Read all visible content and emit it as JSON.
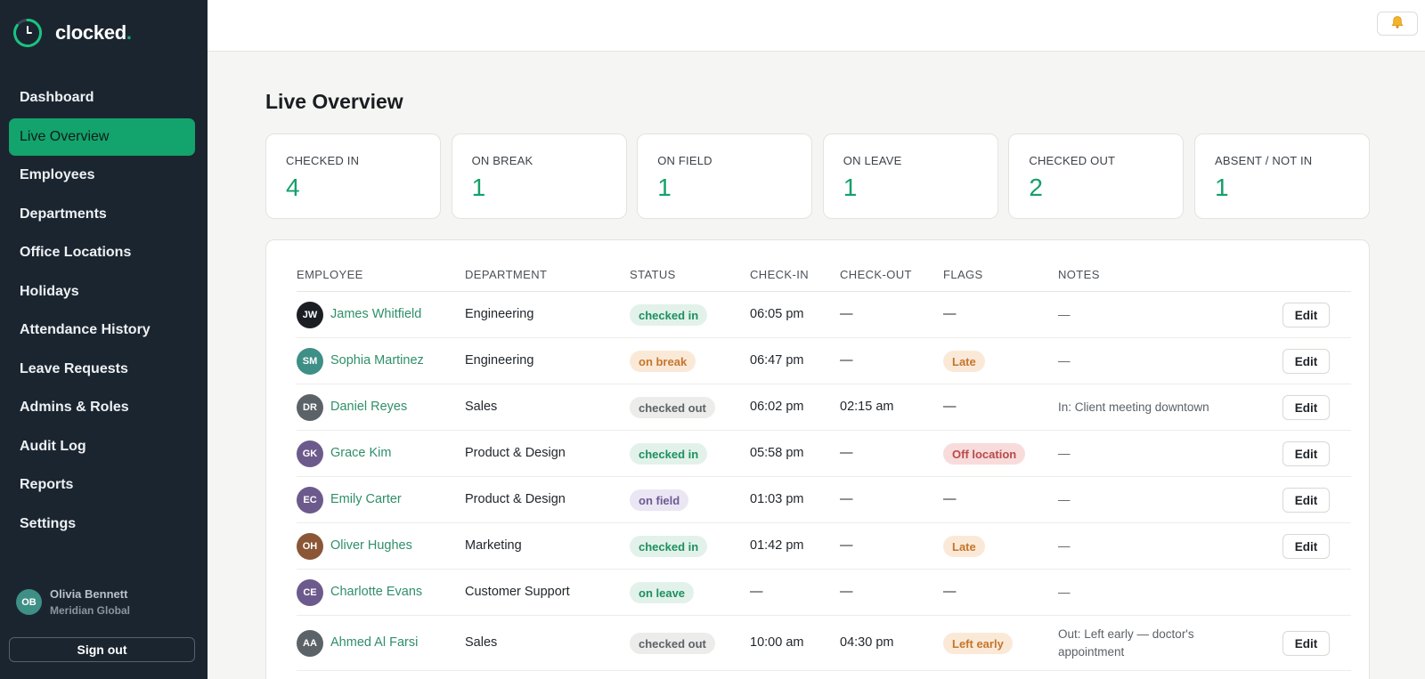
{
  "app": {
    "name": "clocked",
    "name_dot": "."
  },
  "sidebar": {
    "items": [
      {
        "label": "Dashboard",
        "active": false
      },
      {
        "label": "Live Overview",
        "active": true
      },
      {
        "label": "Employees",
        "active": false
      },
      {
        "label": "Departments",
        "active": false
      },
      {
        "label": "Office Locations",
        "active": false
      },
      {
        "label": "Holidays",
        "active": false
      },
      {
        "label": "Attendance History",
        "active": false
      },
      {
        "label": "Leave Requests",
        "active": false
      },
      {
        "label": "Admins & Roles",
        "active": false
      },
      {
        "label": "Audit Log",
        "active": false
      },
      {
        "label": "Reports",
        "active": false
      },
      {
        "label": "Settings",
        "active": false
      }
    ],
    "user": {
      "initials": "OB",
      "name": "Olivia Bennett",
      "org": "Meridian Global"
    },
    "signout_label": "Sign out"
  },
  "topbar": {
    "bell_icon": "bell-icon"
  },
  "page": {
    "title": "Live Overview"
  },
  "stats": [
    {
      "label": "CHECKED IN",
      "value": "4"
    },
    {
      "label": "ON BREAK",
      "value": "1"
    },
    {
      "label": "ON FIELD",
      "value": "1"
    },
    {
      "label": "ON LEAVE",
      "value": "1"
    },
    {
      "label": "CHECKED OUT",
      "value": "2"
    },
    {
      "label": "ABSENT / NOT IN",
      "value": "1"
    }
  ],
  "table": {
    "columns": [
      "EMPLOYEE",
      "DEPARTMENT",
      "STATUS",
      "CHECK-IN",
      "CHECK-OUT",
      "FLAGS",
      "NOTES"
    ],
    "edit_label": "Edit",
    "rows": [
      {
        "initials": "JW",
        "avatar_color": "#1b1f23",
        "name": "James Whitfield",
        "department": "Engineering",
        "status": "checked in",
        "check_in": "06:05 pm",
        "check_out": "—",
        "flag": "—",
        "notes": "—",
        "editable": true
      },
      {
        "initials": "SM",
        "avatar_color": "#3e8f86",
        "name": "Sophia Martinez",
        "department": "Engineering",
        "status": "on break",
        "check_in": "06:47 pm",
        "check_out": "—",
        "flag": "Late",
        "notes": "—",
        "editable": true
      },
      {
        "initials": "DR",
        "avatar_color": "#5b6268",
        "name": "Daniel Reyes",
        "department": "Sales",
        "status": "checked out",
        "check_in": "06:02 pm",
        "check_out": "02:15 am",
        "flag": "—",
        "notes": "In: Client meeting downtown",
        "editable": true
      },
      {
        "initials": "GK",
        "avatar_color": "#6d5a8c",
        "name": "Grace Kim",
        "department": "Product & Design",
        "status": "checked in",
        "check_in": "05:58 pm",
        "check_out": "—",
        "flag": "Off location",
        "notes": "—",
        "editable": true
      },
      {
        "initials": "EC",
        "avatar_color": "#6d5a8c",
        "name": "Emily Carter",
        "department": "Product & Design",
        "status": "on field",
        "check_in": "01:03 pm",
        "check_out": "—",
        "flag": "—",
        "notes": "—",
        "editable": true
      },
      {
        "initials": "OH",
        "avatar_color": "#8a5636",
        "name": "Oliver Hughes",
        "department": "Marketing",
        "status": "checked in",
        "check_in": "01:42 pm",
        "check_out": "—",
        "flag": "Late",
        "notes": "—",
        "editable": true
      },
      {
        "initials": "CE",
        "avatar_color": "#6d5a8c",
        "name": "Charlotte Evans",
        "department": "Customer Support",
        "status": "on leave",
        "check_in": "—",
        "check_out": "—",
        "flag": "—",
        "notes": "—",
        "editable": false
      },
      {
        "initials": "AA",
        "avatar_color": "#5b6268",
        "name": "Ahmed Al Farsi",
        "department": "Sales",
        "status": "checked out",
        "check_in": "10:00 am",
        "check_out": "04:30 pm",
        "flag": "Left early",
        "notes": "Out: Left early — doctor's appointment",
        "editable": true
      }
    ]
  },
  "colors": {
    "accent": "#13a36c",
    "sidebar_bg": "#1b2530",
    "status_checked_in": "#e2f2ea",
    "status_on_break": "#fbe9d8",
    "status_checked_out": "#ececea",
    "status_on_field": "#ebe6f3",
    "flag_late": "#fbe9d8",
    "flag_off_location": "#f8dcdc",
    "flag_left_early": "#fbe9d8"
  }
}
